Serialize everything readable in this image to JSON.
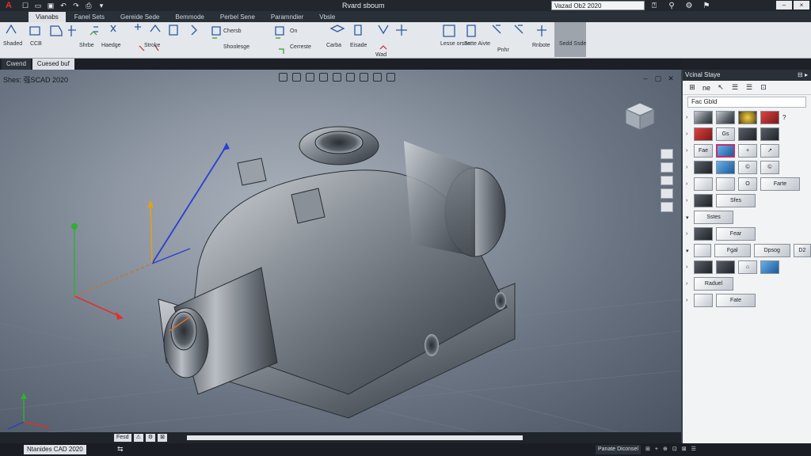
{
  "titlebar": {
    "title": "Rvard sboum",
    "search_value": "Vazad Ob2 2020"
  },
  "ribbon_tabs": [
    {
      "label": "Vianabs",
      "active": true
    },
    {
      "label": "Fanel Sets",
      "active": false
    },
    {
      "label": "Gereide Sede",
      "active": false
    },
    {
      "label": "Bemmode",
      "active": false
    },
    {
      "label": "Perbel Sene",
      "active": false
    },
    {
      "label": "Paramndier",
      "active": false
    },
    {
      "label": "Vbsle",
      "active": false
    }
  ],
  "ribbon": {
    "labels": {
      "shaded": "Shaded",
      "ccb": "CCB",
      "stroke": "Stroke",
      "haedge": "Haedge",
      "shrbe": "Shrbe",
      "chersb": "Chersb",
      "shoolesge": "Shoolesge",
      "on": "On",
      "cerreste": "Cerreste",
      "carba": "Carba",
      "eisade": "Eisade",
      "wad": "Wad",
      "lesse_orsne": "Lesse orsne",
      "sstte_aivte": "Sstte Aivte",
      "pnhr": "Pnhr",
      "rnbote": "Rnbote",
      "sedd_ssde": "Sedd Ssde"
    }
  },
  "doc_tabs": [
    {
      "label": "Cwend",
      "active": false
    },
    {
      "label": "Cuesed buf",
      "active": true
    }
  ],
  "viewport": {
    "label": "Shes: 强SCAD 2020"
  },
  "layout_tabs": [
    "Fesd",
    "⚠",
    "⚙",
    "⊠"
  ],
  "statusbar": {
    "app_label": "Ntanides CAD 2020",
    "right_items": [
      "Panate Diconsel",
      "⊞",
      "+",
      "⊕",
      "⊡",
      "⊠",
      "☰"
    ]
  },
  "palette": {
    "title": "Vcinal Staye",
    "tools": [
      "⊞",
      "ne",
      "↖",
      "☰",
      "☰",
      "⊡"
    ],
    "field_value": "Fac Gbld",
    "rows": [
      {
        "arrow": "›",
        "swatches": [
          {
            "t": "",
            "c": "metal"
          },
          {
            "t": "",
            "c": "metal"
          },
          {
            "t": "",
            "c": "gold"
          },
          {
            "t": "",
            "c": "red"
          }
        ],
        "extra": "?"
      },
      {
        "arrow": "›",
        "swatches": [
          {
            "t": "",
            "c": "red"
          },
          {
            "t": "Gs",
            "c": "light"
          },
          {
            "t": "",
            "c": "dark"
          },
          {
            "t": "",
            "c": "dark"
          }
        ],
        "extra": ""
      },
      {
        "arrow": "›",
        "swatches": [
          {
            "t": "Fae",
            "c": "light"
          },
          {
            "t": "",
            "c": "blue"
          },
          {
            "t": "+",
            "c": "light"
          },
          {
            "t": "↗",
            "c": "light"
          }
        ],
        "extra": ""
      },
      {
        "arrow": "›",
        "swatches": [
          {
            "t": "",
            "c": "dark"
          },
          {
            "t": "",
            "c": "blue"
          },
          {
            "t": "©",
            "c": "light"
          },
          {
            "t": "©",
            "c": "light"
          }
        ],
        "extra": ""
      },
      {
        "arrow": "›",
        "swatches": [
          {
            "t": "",
            "c": "light"
          },
          {
            "t": "",
            "c": "light"
          },
          {
            "t": "O",
            "c": "light"
          },
          {
            "t": "Farte",
            "c": "light"
          }
        ],
        "extra": ""
      },
      {
        "arrow": "›",
        "swatches": [
          {
            "t": "",
            "c": "dark"
          },
          {
            "t": "Sfes",
            "c": "light"
          }
        ],
        "extra": ""
      },
      {
        "arrow": "▾",
        "swatches": [
          {
            "t": "Sstes",
            "c": "light"
          }
        ],
        "extra": ""
      },
      {
        "arrow": "›",
        "swatches": [
          {
            "t": "",
            "c": "dark"
          },
          {
            "t": "Fear",
            "c": "light"
          }
        ],
        "extra": ""
      },
      {
        "arrow": "▾",
        "swatches": [
          {
            "t": "",
            "c": "light"
          },
          {
            "t": "Fgal",
            "c": "light"
          },
          {
            "t": "Dpsog",
            "c": "light"
          },
          {
            "t": "D2",
            "c": "light"
          }
        ],
        "extra": ""
      },
      {
        "arrow": "›",
        "swatches": [
          {
            "t": "",
            "c": "dark"
          },
          {
            "t": "",
            "c": "dark"
          },
          {
            "t": "⌂",
            "c": "light"
          },
          {
            "t": "",
            "c": "blue"
          }
        ],
        "extra": ""
      },
      {
        "arrow": "›",
        "swatches": [
          {
            "t": "Raduel",
            "c": "light"
          }
        ],
        "extra": ""
      },
      {
        "arrow": "›",
        "swatches": [
          {
            "t": "",
            "c": "light"
          },
          {
            "t": "Fate",
            "c": "light"
          }
        ],
        "extra": ""
      }
    ]
  },
  "colors": {
    "accent": "#e03030",
    "viewport_bg": "#8e97a3",
    "axis_x": "#e0302a",
    "axis_y": "#2fb02f",
    "axis_z": "#2a3fd0"
  }
}
